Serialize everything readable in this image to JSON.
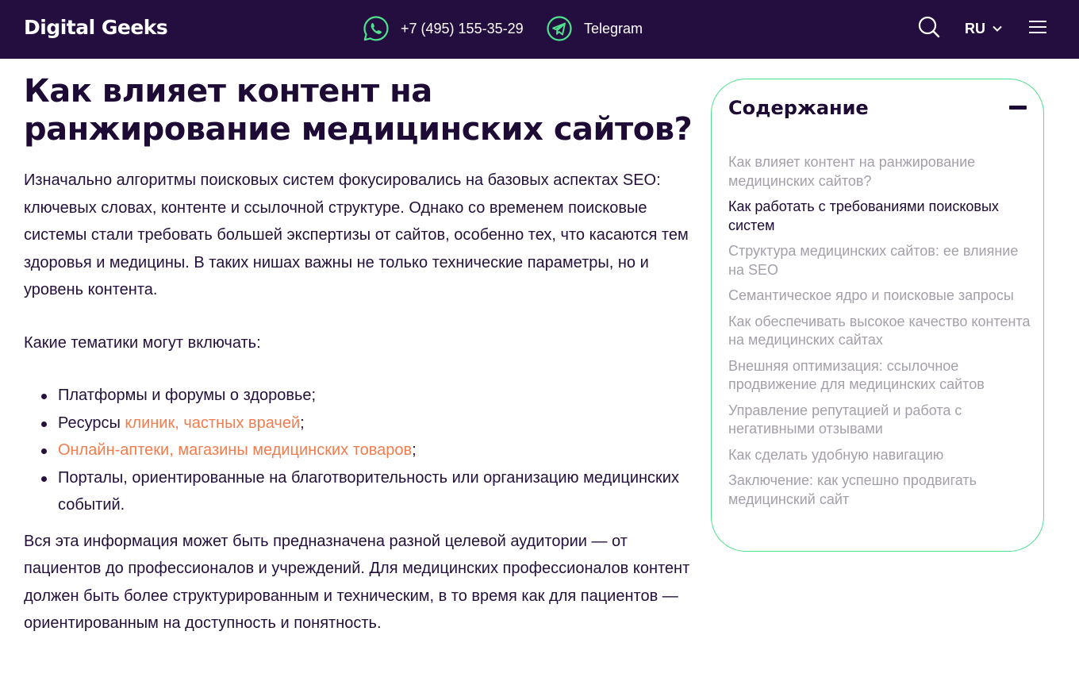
{
  "header": {
    "logo": "Digital Geeks",
    "phone": "+7 (495) 155-35-29",
    "telegram": "Telegram",
    "lang": "RU",
    "icons": {
      "phone": "whatsapp-icon",
      "telegram": "telegram-icon",
      "search": "search-icon",
      "menu": "hamburger-menu-icon",
      "lang_chevron": "chevron-down-icon"
    },
    "colors": {
      "background": "#240e3f",
      "accent": "#4fe18e"
    }
  },
  "article": {
    "title": "Как влияет контент на ранжирование медицинских сайтов?",
    "paragraph1": "Изначально алгоритмы поисковых систем фокусировались на базовых аспектах SEO: ключевых словах, контенте и ссылочной структуре. Однако со временем поисковые системы стали требовать большей экспертизы от сайтов, особенно тех, что касаются тем здоровья и медицины. В таких нишах важны не только технические параметры, но и уровень контента.",
    "paragraph2": "Какие тематики могут включать:",
    "bullets": [
      {
        "text": "Платформы и форумы о здоровье;"
      },
      {
        "prefix": "Ресурсы ",
        "link": "клиник, частных врачей",
        "suffix": ";"
      },
      {
        "link": "Онлайн-аптеки, магазины медицинских товаров",
        "suffix": ";"
      },
      {
        "text": "Порталы, ориентированные на благотворительность или организацию медицинских событий."
      }
    ],
    "paragraph3": "Вся эта информация может быть предназначена разной целевой аудитории — от пациентов до профессионалов и учреждений. Для медицинских профессионалов контент должен быть более структурированным и техническим, в то время как для пациентов — ориентированным на доступность и понятность.",
    "link_color": "#f47c4c"
  },
  "toc": {
    "title": "Содержание",
    "collapse_icon": "minus-icon",
    "items": [
      "Как влияет контент на ранжирование медицинских сайтов?",
      "Как работать с требованиями поисковых систем",
      "Структура медицинских сайтов: ее влияние на SEO",
      "Семантическое ядро и поисковые запросы",
      "Как обеспечивать высокое качество контента на медицинских сайтах",
      "Внешняя оптимизация: ссылочное продвижение для медицинских сайтов",
      "Управление репутацией и работа с негативными отзывами",
      "Как сделать удобную навигацию",
      "Заключение: как успешно продвигать медицинский сайт"
    ],
    "active_index": 1
  }
}
